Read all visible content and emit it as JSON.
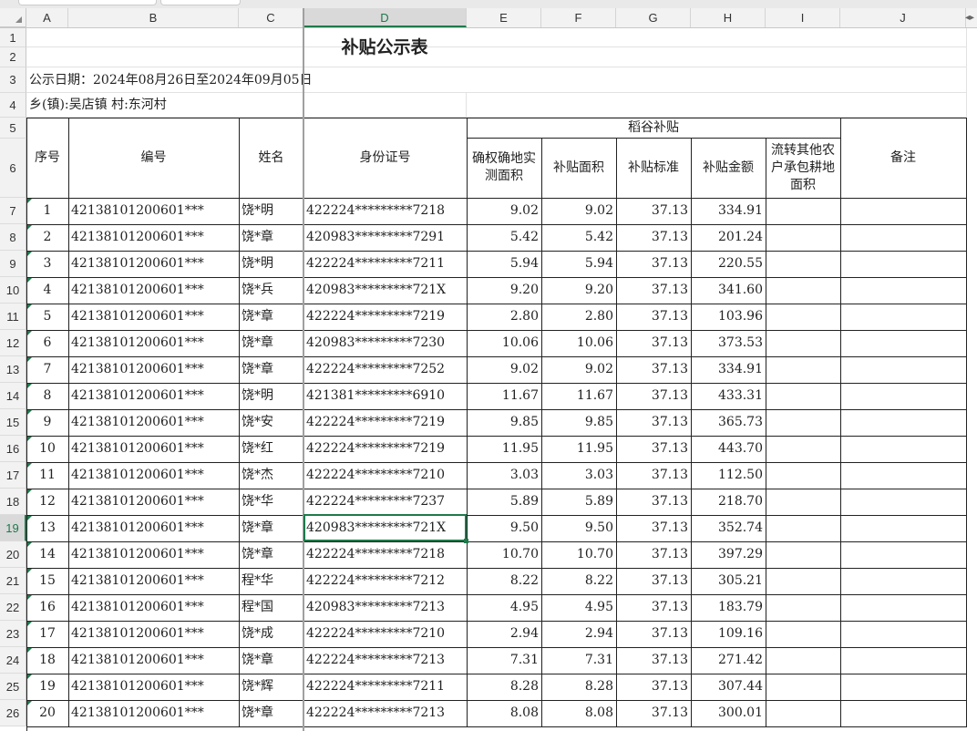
{
  "columns": [
    "A",
    "B",
    "C",
    "D",
    "E",
    "F",
    "G",
    "H",
    "I",
    "J"
  ],
  "selected_column": "D",
  "selected_row": "19",
  "title": "补贴公示表",
  "date_line": "公示日期：2024年08月26日至2024年09月05日",
  "location_line": "乡(镇):吴店镇 村:东河村",
  "headers": {
    "seq": "序号",
    "code": "编号",
    "name": "姓名",
    "id": "身份证号",
    "group": "稻谷补贴",
    "area_measured": "确权确地实测面积",
    "area_subsidy": "补贴面积",
    "standard": "补贴标准",
    "amount": "补贴金额",
    "transfer": "流转其他农户承包耕地面积",
    "remark": "备注"
  },
  "row_numbers": [
    "1",
    "2",
    "3",
    "4",
    "5",
    "6",
    "7",
    "8",
    "9",
    "10",
    "11",
    "12",
    "13",
    "14",
    "15",
    "16",
    "17",
    "18",
    "19",
    "20",
    "21",
    "22",
    "23",
    "24",
    "25",
    "26"
  ],
  "rows": [
    {
      "seq": "1",
      "code": "42138101200601***",
      "name": "饶*明",
      "id": "422224*********7218",
      "area": "9.02",
      "sub": "9.02",
      "std": "37.13",
      "amt": "334.91"
    },
    {
      "seq": "2",
      "code": "42138101200601***",
      "name": "饶*章",
      "id": "420983*********7291",
      "area": "5.42",
      "sub": "5.42",
      "std": "37.13",
      "amt": "201.24"
    },
    {
      "seq": "3",
      "code": "42138101200601***",
      "name": "饶*明",
      "id": "422224*********7211",
      "area": "5.94",
      "sub": "5.94",
      "std": "37.13",
      "amt": "220.55"
    },
    {
      "seq": "4",
      "code": "42138101200601***",
      "name": "饶*兵",
      "id": "420983*********721X",
      "area": "9.20",
      "sub": "9.20",
      "std": "37.13",
      "amt": "341.60"
    },
    {
      "seq": "5",
      "code": "42138101200601***",
      "name": "饶*章",
      "id": "422224*********7219",
      "area": "2.80",
      "sub": "2.80",
      "std": "37.13",
      "amt": "103.96"
    },
    {
      "seq": "6",
      "code": "42138101200601***",
      "name": "饶*章",
      "id": "420983*********7230",
      "area": "10.06",
      "sub": "10.06",
      "std": "37.13",
      "amt": "373.53"
    },
    {
      "seq": "7",
      "code": "42138101200601***",
      "name": "饶*章",
      "id": "422224*********7252",
      "area": "9.02",
      "sub": "9.02",
      "std": "37.13",
      "amt": "334.91"
    },
    {
      "seq": "8",
      "code": "42138101200601***",
      "name": "饶*明",
      "id": "421381*********6910",
      "area": "11.67",
      "sub": "11.67",
      "std": "37.13",
      "amt": "433.31"
    },
    {
      "seq": "9",
      "code": "42138101200601***",
      "name": "饶*安",
      "id": "422224*********7219",
      "area": "9.85",
      "sub": "9.85",
      "std": "37.13",
      "amt": "365.73"
    },
    {
      "seq": "10",
      "code": "42138101200601***",
      "name": "饶*红",
      "id": "422224*********7219",
      "area": "11.95",
      "sub": "11.95",
      "std": "37.13",
      "amt": "443.70"
    },
    {
      "seq": "11",
      "code": "42138101200601***",
      "name": "饶*杰",
      "id": "422224*********7210",
      "area": "3.03",
      "sub": "3.03",
      "std": "37.13",
      "amt": "112.50"
    },
    {
      "seq": "12",
      "code": "42138101200601***",
      "name": "饶*华",
      "id": "422224*********7237",
      "area": "5.89",
      "sub": "5.89",
      "std": "37.13",
      "amt": "218.70"
    },
    {
      "seq": "13",
      "code": "42138101200601***",
      "name": "饶*章",
      "id": "420983*********721X",
      "area": "9.50",
      "sub": "9.50",
      "std": "37.13",
      "amt": "352.74"
    },
    {
      "seq": "14",
      "code": "42138101200601***",
      "name": "饶*章",
      "id": "422224*********7218",
      "area": "10.70",
      "sub": "10.70",
      "std": "37.13",
      "amt": "397.29"
    },
    {
      "seq": "15",
      "code": "42138101200601***",
      "name": "程*华",
      "id": "422224*********7212",
      "area": "8.22",
      "sub": "8.22",
      "std": "37.13",
      "amt": "305.21"
    },
    {
      "seq": "16",
      "code": "42138101200601***",
      "name": "程*国",
      "id": "420983*********7213",
      "area": "4.95",
      "sub": "4.95",
      "std": "37.13",
      "amt": "183.79"
    },
    {
      "seq": "17",
      "code": "42138101200601***",
      "name": "饶*成",
      "id": "422224*********7210",
      "area": "2.94",
      "sub": "2.94",
      "std": "37.13",
      "amt": "109.16"
    },
    {
      "seq": "18",
      "code": "42138101200601***",
      "name": "饶*章",
      "id": "422224*********7213",
      "area": "7.31",
      "sub": "7.31",
      "std": "37.13",
      "amt": "271.42"
    },
    {
      "seq": "19",
      "code": "42138101200601***",
      "name": "饶*辉",
      "id": "422224*********7211",
      "area": "8.28",
      "sub": "8.28",
      "std": "37.13",
      "amt": "307.44"
    },
    {
      "seq": "20",
      "code": "42138101200601***",
      "name": "饶*章",
      "id": "422224*********7213",
      "area": "8.08",
      "sub": "8.08",
      "std": "37.13",
      "amt": "300.01"
    }
  ],
  "colors": {
    "accent": "#1e7a4b",
    "header_bg": "#f2f2f2",
    "border": "#222222"
  },
  "icons": {
    "corner": "select-all-triangle-icon",
    "scroll": "horizontal-split-arrows-icon"
  }
}
